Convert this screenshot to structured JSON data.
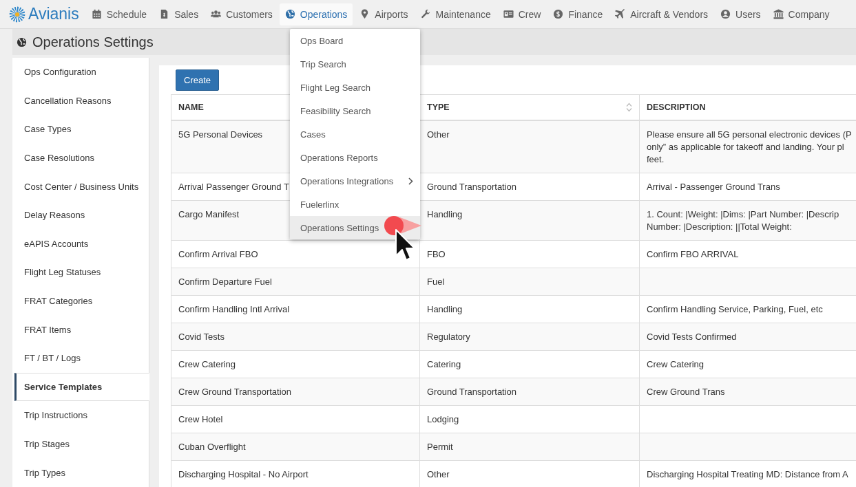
{
  "brand": {
    "name": "Avianis"
  },
  "nav": [
    {
      "label": "Schedule",
      "selected": false
    },
    {
      "label": "Sales",
      "selected": false
    },
    {
      "label": "Customers",
      "selected": false
    },
    {
      "label": "Operations",
      "selected": true
    },
    {
      "label": "Airports",
      "selected": false
    },
    {
      "label": "Maintenance",
      "selected": false
    },
    {
      "label": "Crew",
      "selected": false
    },
    {
      "label": "Finance",
      "selected": false
    },
    {
      "label": "Aircraft & Vendors",
      "selected": false
    },
    {
      "label": "Users",
      "selected": false
    },
    {
      "label": "Company",
      "selected": false
    }
  ],
  "dropdown": [
    {
      "label": "Ops Board",
      "highlighted": false,
      "has_submenu": false
    },
    {
      "label": "Trip Search",
      "highlighted": false,
      "has_submenu": false
    },
    {
      "label": "Flight Leg Search",
      "highlighted": false,
      "has_submenu": false
    },
    {
      "label": "Feasibility Search",
      "highlighted": false,
      "has_submenu": false
    },
    {
      "label": "Cases",
      "highlighted": false,
      "has_submenu": false
    },
    {
      "label": "Operations Reports",
      "highlighted": false,
      "has_submenu": false
    },
    {
      "label": "Operations Integrations",
      "highlighted": false,
      "has_submenu": true
    },
    {
      "label": "Fuelerlinx",
      "highlighted": false,
      "has_submenu": false
    },
    {
      "label": "Operations Settings",
      "highlighted": true,
      "has_submenu": false
    }
  ],
  "page_title": "Operations Settings",
  "sidebar": {
    "items": [
      {
        "label": "Ops Configuration",
        "selected": false
      },
      {
        "label": "Cancellation Reasons",
        "selected": false
      },
      {
        "label": "Case Types",
        "selected": false
      },
      {
        "label": "Case Resolutions",
        "selected": false
      },
      {
        "label": "Cost Center / Business Units",
        "selected": false
      },
      {
        "label": "Delay Reasons",
        "selected": false
      },
      {
        "label": "eAPIS Accounts",
        "selected": false
      },
      {
        "label": "Flight Leg Statuses",
        "selected": false
      },
      {
        "label": "FRAT Categories",
        "selected": false
      },
      {
        "label": "FRAT Items",
        "selected": false
      },
      {
        "label": "FT / BT / Logs",
        "selected": false
      },
      {
        "label": "Service Templates",
        "selected": true
      },
      {
        "label": "Trip Instructions",
        "selected": false
      },
      {
        "label": "Trip Stages",
        "selected": false
      },
      {
        "label": "Trip Types",
        "selected": false
      }
    ]
  },
  "create_button": "Create",
  "table": {
    "columns": [
      {
        "label": "NAME",
        "sortable": false
      },
      {
        "label": "TYPE",
        "sortable": true
      },
      {
        "label": "DESCRIPTION",
        "sortable": false
      }
    ],
    "rows": [
      {
        "name": "5G Personal Devices",
        "type": "Other",
        "description": [
          "Please ensure all 5G personal electronic devices (P",
          "only” as applicable for takeoff and landing. Your pl",
          "feet."
        ]
      },
      {
        "name": "Arrival Passenger Ground T",
        "type": "Ground Transportation",
        "description": [
          "Arrival - Passenger Ground Trans"
        ]
      },
      {
        "name": "Cargo Manifest",
        "type": "Handling",
        "description": [
          "1. Count: |Weight: |Dims: |Part Number: |Descrip",
          "Number: |Description: ||Total Weight:"
        ]
      },
      {
        "name": "Confirm Arrival FBO",
        "type": "FBO",
        "description": [
          "Confirm FBO ARRIVAL"
        ]
      },
      {
        "name": "Confirm Departure Fuel",
        "type": "Fuel"
      },
      {
        "name": "Confirm Handling Intl Arrival",
        "type": "Handling",
        "description": [
          "Confirm Handling Service, Parking, Fuel, etc"
        ]
      },
      {
        "name": "Covid Tests",
        "type": "Regulatory",
        "description": [
          "Covid Tests Confirmed"
        ]
      },
      {
        "name": "Crew Catering",
        "type": "Catering",
        "description": [
          "Crew Catering"
        ]
      },
      {
        "name": "Crew Ground Transportation",
        "type": "Ground Transportation",
        "description": [
          "Crew Ground Trans"
        ]
      },
      {
        "name": "Crew Hotel",
        "type": "Lodging"
      },
      {
        "name": "Cuban Overflight",
        "type": "Permit"
      },
      {
        "name": "Discharging Hospital - No Airport",
        "type": "Other",
        "description": [
          "Discharging Hospital Treating MD: Distance from A"
        ]
      }
    ]
  }
}
